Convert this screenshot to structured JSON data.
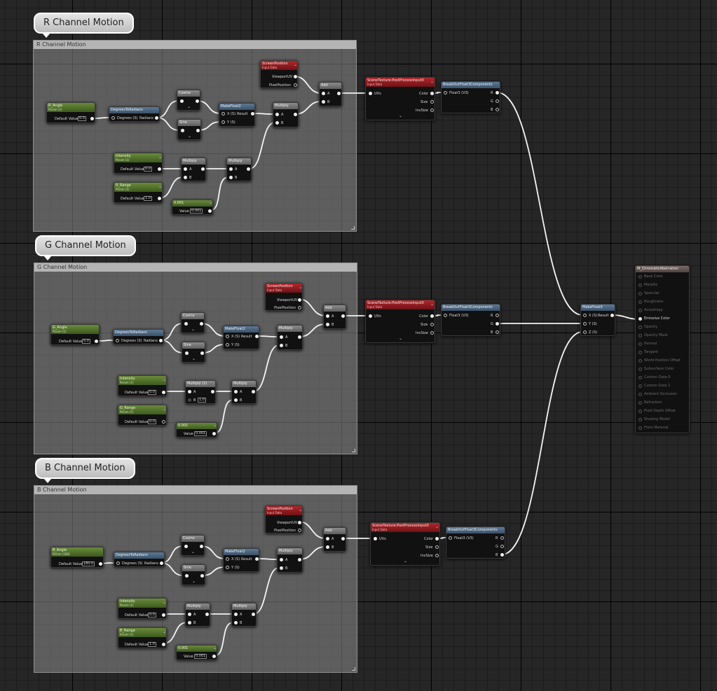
{
  "comments": {
    "r": "R Channel Motion",
    "g": "G Channel Motion",
    "b": "B Channel Motion"
  },
  "groups": {
    "r": "R Channel Motion",
    "g": "G Channel Motion",
    "b": "B Channel Motion"
  },
  "common": {
    "param_sub": "Param (1)",
    "default_value": "Default Value",
    "deg_to_rad": "DegreesToRadians",
    "deg_in": "Degrees (S)",
    "rad_out": "Radians",
    "cosine": "Cosine",
    "sine": "Sine",
    "makefloat2": "MakeFloat2",
    "x_s": "X (S)",
    "y_s": "Y (S)",
    "z_s": "Z (S)",
    "result": "Result",
    "multiply": "Multiply",
    "a": "A",
    "b": "B",
    "add": "Add",
    "screen_position": "ScreenPosition",
    "input_data": "Input Data",
    "viewport_uv": "ViewportUV",
    "pixel_position": "PixelPosition",
    "scene_texture": "SceneTexture:PostProcessInput0",
    "uvs": "UVs",
    "color": "Color",
    "size": "Size",
    "invsize": "InvSize",
    "break_float3": "BreakOutFloat3Components",
    "float3": "Float3 (V3)",
    "r": "R",
    "g": "G",
    "b_out": "B",
    "value": "Value",
    "intensity": "Intensity",
    "makefloat3": "MakeFloat3"
  },
  "r": {
    "angle": "R_Angle",
    "angle_val": "0.0",
    "angle_sub": "Param (1)",
    "intensity_val": "0.0",
    "range": "R_Range",
    "range_val": "1.0",
    "const": "0.001",
    "const_val": "0.001"
  },
  "g": {
    "angle": "G_Angle",
    "angle_val": "0.0",
    "angle_sub": "Param (1)",
    "intensity_val": "0.0",
    "range": "G_Range",
    "range_val": "0.0",
    "const": "0.001",
    "const_val": "0.001",
    "mul_title": "Multiply (1)",
    "b_val": "1.0"
  },
  "b": {
    "angle": "B_Angle",
    "angle_val": "180.0",
    "angle_sub": "Param (180)",
    "intensity_val": "0.0",
    "range": "B_Range",
    "range_val": "1.0",
    "const": "0.001",
    "const_val": "0.001"
  },
  "material": {
    "title": "M_ChromaticAberration",
    "pins": [
      "Base Color",
      "Metallic",
      "Specular",
      "Roughness",
      "Anisotropy",
      "Emissive Color",
      "Opacity",
      "Opacity Mask",
      "Normal",
      "Tangent",
      "World Position Offset",
      "Subsurface Color",
      "Custom Data 0",
      "Custom Data 1",
      "Ambient Occlusion",
      "Refraction",
      "Pixel Depth Offset",
      "Shading Model",
      "Front Material"
    ],
    "active_pin": "Emissive Color"
  }
}
